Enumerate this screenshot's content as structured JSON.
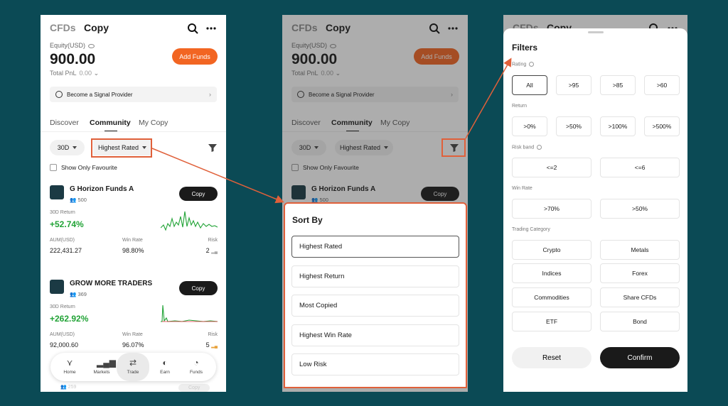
{
  "app": {
    "tab_cfds": "CFDs",
    "tab_copy": "Copy",
    "equity_label": "Equity(USD)",
    "equity_value": "900.00",
    "total_pnl_label": "Total PnL",
    "total_pnl_value": "0.00",
    "add_funds": "Add Funds",
    "signal_provider": "Become a Signal Provider",
    "subtabs": [
      "Discover",
      "Community",
      "My Copy"
    ],
    "period_chip": "30D",
    "sort_chip": "Highest Rated",
    "show_fav": "Show Only Favourite"
  },
  "cards": [
    {
      "name": "G Horizon Funds A",
      "followers": "500",
      "copy": "Copy",
      "return_label": "30D Return",
      "return_value": "+52.74%",
      "aum_label": "AUM(USD)",
      "aum_value": "222,431.27",
      "winrate_label": "Win Rate",
      "winrate_value": "98.80%",
      "risk_label": "Risk",
      "risk_value": "2"
    },
    {
      "name": "GROW MORE TRADERS",
      "followers": "369",
      "copy": "Copy",
      "return_label": "30D Return",
      "return_value": "+262.92%",
      "aum_label": "AUM(USD)",
      "aum_value": "92,000.60",
      "winrate_label": "Win Rate",
      "winrate_value": "96.07%",
      "risk_label": "Risk",
      "risk_value": "5"
    }
  ],
  "ghost_row": {
    "followers": "259",
    "copy": "Copy"
  },
  "nav": [
    {
      "label": "Home",
      "icon": "home-icon"
    },
    {
      "label": "Markets",
      "icon": "markets-icon"
    },
    {
      "label": "Trade",
      "icon": "trade-icon"
    },
    {
      "label": "Earn",
      "icon": "earn-icon"
    },
    {
      "label": "Funds",
      "icon": "funds-icon"
    }
  ],
  "sort": {
    "title": "Sort By",
    "options": [
      "Highest Rated",
      "Highest Return",
      "Most Copied",
      "Highest Win Rate",
      "Low Risk"
    ],
    "selected": "Highest Rated"
  },
  "filters": {
    "title": "Filters",
    "rating_label": "Rating",
    "rating": [
      "All",
      ">95",
      ">85",
      ">60"
    ],
    "return_label": "Return",
    "return": [
      ">0%",
      ">50%",
      ">100%",
      ">500%"
    ],
    "riskband_label": "Risk band",
    "riskband": [
      "<=2",
      "<=6"
    ],
    "winrate_label": "Win Rate",
    "winrate": [
      ">70%",
      ">50%"
    ],
    "category_label": "Trading Category",
    "category": [
      "Crypto",
      "Metals",
      "Indices",
      "Forex",
      "Commodities",
      "Share CFDs",
      "ETF",
      "Bond"
    ],
    "reset": "Reset",
    "confirm": "Confirm"
  },
  "colors": {
    "accent": "#f26522",
    "positive": "#21a336",
    "highlight": "#e0603a",
    "background": "#0b4a55"
  }
}
